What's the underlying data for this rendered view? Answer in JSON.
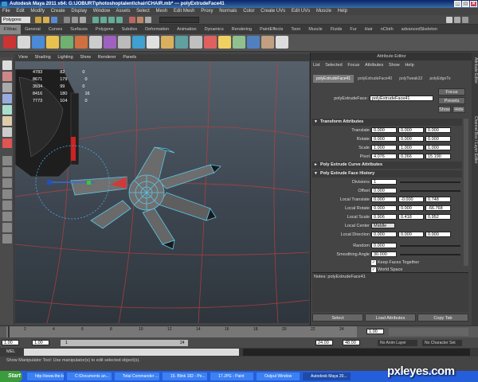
{
  "window": {
    "title": "Autodesk Maya 2011 x64: G:\\JOBURT\\photoshoptalent\\chair\\CHAIR.mb*  ---  polyExtrudeFace41",
    "minimize": "_",
    "maximize": "□",
    "close": "✕"
  },
  "menubar": [
    "File",
    "Edit",
    "Modify",
    "Create",
    "Display",
    "Window",
    "Assets",
    "Select",
    "Mesh",
    "Edit Mesh",
    "Proxy",
    "Normals",
    "Color",
    "Create UVs",
    "Edit UVs",
    "Muscle",
    "Help"
  ],
  "statusline": {
    "mode": "Polygons"
  },
  "shelf_tabs": {
    "items": [
      "FXtrac",
      "General",
      "Curves",
      "Surfaces",
      "Polygons",
      "Subdivs",
      "Deformation",
      "Animation",
      "Dynamics",
      "Rendering",
      "PaintEffects",
      "Toon",
      "Muscle",
      "Fluids",
      "Fur",
      "Hair",
      "nCloth",
      "advancedSkeleton"
    ],
    "active": "FXtrac"
  },
  "viewport": {
    "menu": [
      "View",
      "Shading",
      "Lighting",
      "Show",
      "Renderer",
      "Panels"
    ],
    "hud_rows": [
      [
        "4783",
        "82",
        "0"
      ],
      [
        "8671",
        "179",
        "0"
      ],
      [
        "3934",
        "99",
        "0"
      ],
      [
        "8416",
        "180",
        "16"
      ],
      [
        "7773",
        "104",
        "0"
      ]
    ]
  },
  "attribute_editor": {
    "title": "Attribute Editor",
    "menu": [
      "List",
      "Selected",
      "Focus",
      "Attributes",
      "Show",
      "Help"
    ],
    "tabs": [
      "polyExtrudeFace41",
      "polyExtrudeFace40",
      "polyTweak32",
      "polyEdgeTo"
    ],
    "active_tab": "polyExtrudeFace41",
    "node_label": "polyExtrudeFace:",
    "node_value": "polyExtrudeFace41",
    "focus_button": "Focus",
    "presets_button": "Presets",
    "show_button": "Show",
    "hide_button": "Hide",
    "transform": {
      "header": "Transform Attributes",
      "rows": [
        {
          "label": "Translate",
          "values": [
            "0.000",
            "0.000",
            "0.000"
          ]
        },
        {
          "label": "Rotate",
          "values": [
            "0.000",
            "0.000",
            "0.000"
          ]
        },
        {
          "label": "Scale",
          "values": [
            "1.000",
            "1.000",
            "1.000"
          ]
        },
        {
          "label": "Pivot",
          "values": [
            "4.076",
            "0.266",
            "15.190"
          ]
        }
      ]
    },
    "curve_header": "Poly Extrude Curve Attributes",
    "history": {
      "header": "Poly Extrude Face History",
      "divisions": {
        "label": "Divisions",
        "value": "1"
      },
      "offset": {
        "label": "Offset",
        "value": "0.000"
      },
      "local_translate": {
        "label": "Local Translate",
        "values": [
          "0.000",
          "-0.000",
          "0.748"
        ]
      },
      "local_rotate": {
        "label": "Local Rotate",
        "values": [
          "0.000",
          "0.000",
          "-66.768"
        ]
      },
      "local_scale": {
        "label": "Local Scale",
        "values": [
          "0.906",
          "0.418",
          "0.952"
        ]
      },
      "local_center": {
        "label": "Local Center",
        "value": "Middle"
      },
      "local_direction": {
        "label": "Local Direction",
        "values": [
          "0.000",
          "0.000",
          "0.000"
        ]
      },
      "random": {
        "label": "Random",
        "value": "0.000"
      },
      "smoothing": {
        "label": "Smoothing Angle",
        "value": "30.000"
      },
      "keep_faces": "Keep Faces Together",
      "world_space": "World Space"
    },
    "notes_label": "Notes:  polyExtrudeFace41",
    "buttons": [
      "Select",
      "Load Attributes",
      "Copy Tab"
    ]
  },
  "side_tabs": [
    "Attribute Editor",
    "Channel Box / Layer Editor"
  ],
  "timeline": {
    "ticks": [
      "2",
      "4",
      "6",
      "8",
      "10",
      "12",
      "14",
      "16",
      "18",
      "20",
      "22",
      "24"
    ],
    "current_frame": "1.00"
  },
  "range": {
    "start": "1.00",
    "start2": "1.00",
    "inner": "1",
    "end_inner": "24",
    "end": "24.00",
    "end2": "48.00",
    "anim_layer": "No Anim Layer",
    "char_set": "No Character Set"
  },
  "mel_label": "MEL",
  "help_text": "Show Manipulator Tool: Use manipulator(s) to edit selected object(s).",
  "taskbar": {
    "start": "Start",
    "items": [
      "http://www.the-bl...",
      "C:\\Documents an...",
      "Total Commander ...",
      "15. Blink 182 - Pe...",
      "17.JPG - Paint",
      "Output Window",
      "Autodesk Maya 20..."
    ],
    "active": "Autodesk Maya 20..."
  },
  "watermark": "pxleyes.com",
  "colors": {
    "accent": "#5bc6e8",
    "selection": "#d33",
    "background": "#444444"
  }
}
